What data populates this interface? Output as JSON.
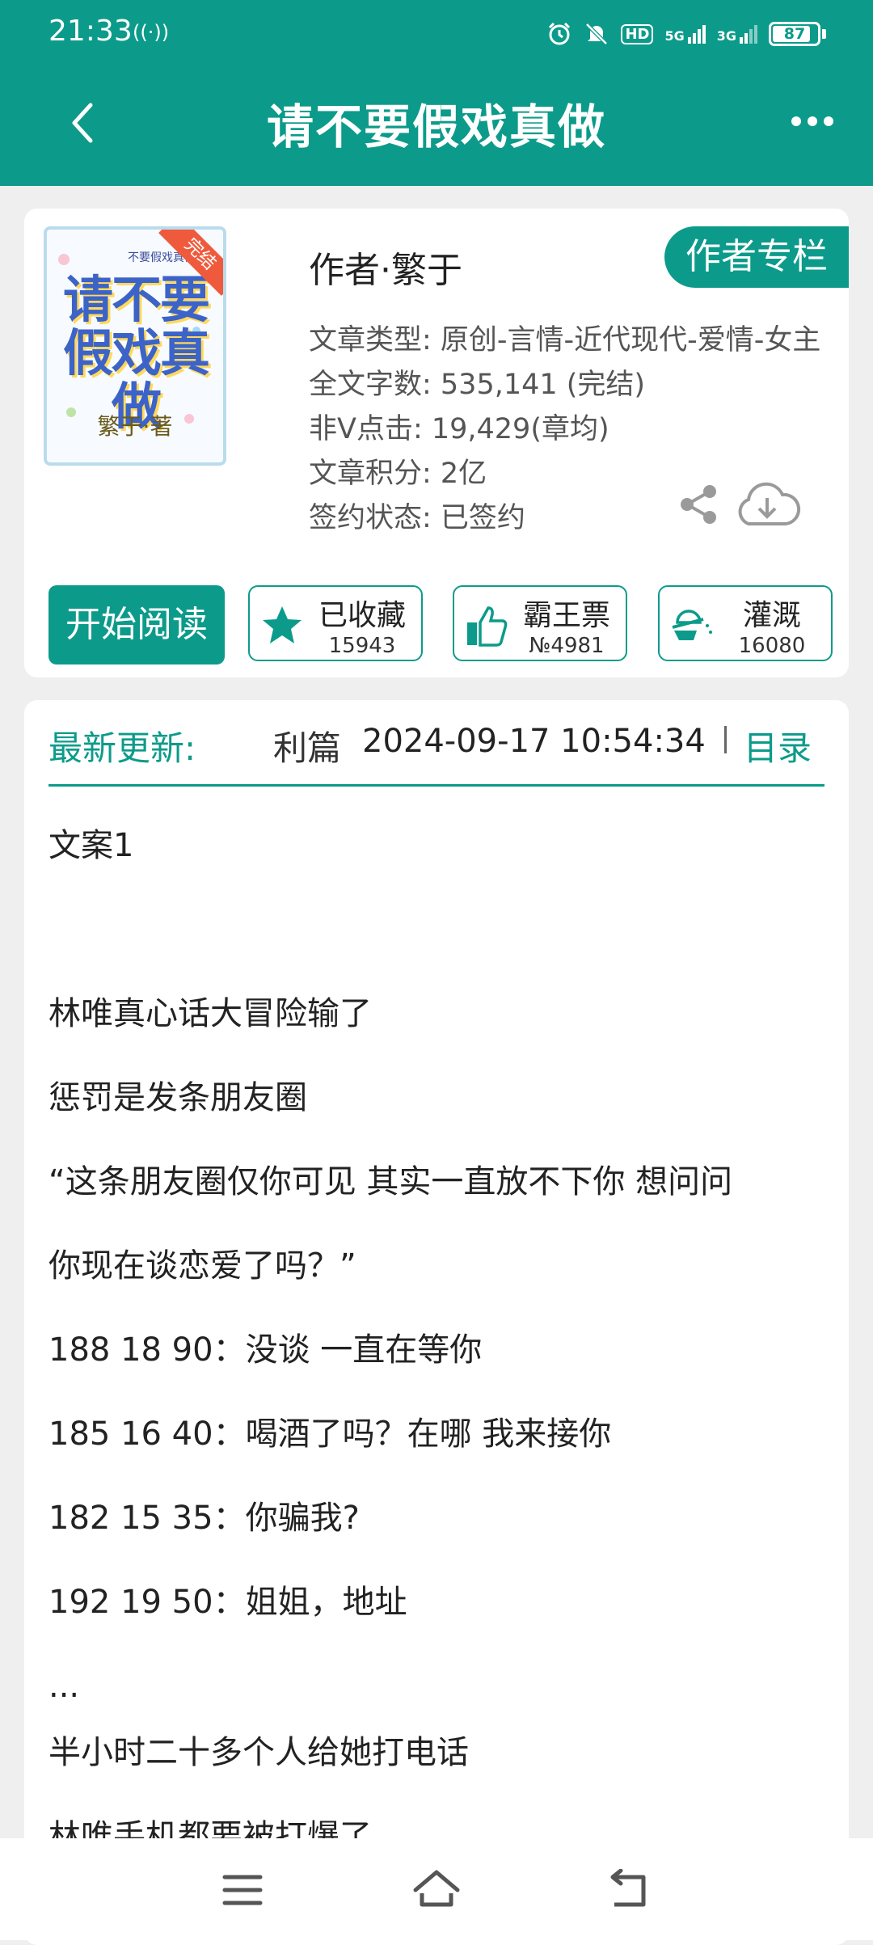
{
  "status_bar": {
    "time": "21:33",
    "battery": "87",
    "battery_level": 0.87,
    "icons": [
      "signal-broadcast-icon",
      "alarm-icon",
      "mute-icon",
      "hd-icon",
      "5g-signal-icon",
      "3g-signal-icon",
      "battery-icon"
    ],
    "net1": "5G",
    "net2": "3G",
    "hd": "HD"
  },
  "header": {
    "title": "请不要假戏真做",
    "back_icon": "chevron-left-icon",
    "more_icon": "more-dots-icon"
  },
  "book": {
    "cover_title": "请不要假戏真做",
    "cover_tag": "完结",
    "cover_small_text": "不要假戏真做",
    "cover_author": "繁于·著",
    "author": "作者·繁于",
    "author_column_label": "作者专栏",
    "info": [
      "文章类型: 原创-言情-近代现代-爱情-女主",
      "全文字数: 535,141 (完结)",
      "非Ⅴ点击: 19,429(章均)",
      "文章积分: 2亿",
      "签约状态: 已签约"
    ],
    "share_icon": "share-icon",
    "download_icon": "cloud-download-icon"
  },
  "actions": {
    "read_label": "开始阅读",
    "favorite": {
      "label": "已收藏",
      "count": "15943",
      "icon": "star-icon"
    },
    "ticket": {
      "label": "霸王票",
      "count": "№4981",
      "icon": "thumbs-up-icon"
    },
    "irrigate": {
      "label": "灌溉",
      "count": "16080",
      "icon": "watering-can-icon"
    }
  },
  "latest_update": {
    "label": "最新更新:",
    "chapter": "利篇",
    "time": "2024-09-17 10:54:34",
    "toc_label": "目录"
  },
  "synopsis": [
    "文案1",
    "",
    "林唯真心话大冒险输了",
    "惩罚是发条朋友圈",
    "“这条朋友圈仅你可见 其实一直放不下你 想问问",
    "你现在谈恋爱了吗？”",
    "188 18 90：没谈 一直在等你",
    "185 16 40：喝酒了吗？在哪 我来接你",
    "182 15 35：你骗我?",
    "192 19 50：姐姐，地址",
    "...",
    "半小时二十多个人给她打电话",
    "林唯手机都要被打爆了"
  ],
  "nav_bar": {
    "menu_icon": "menu-icon",
    "home_icon": "home-icon",
    "back_icon": "back-arrow-icon"
  }
}
